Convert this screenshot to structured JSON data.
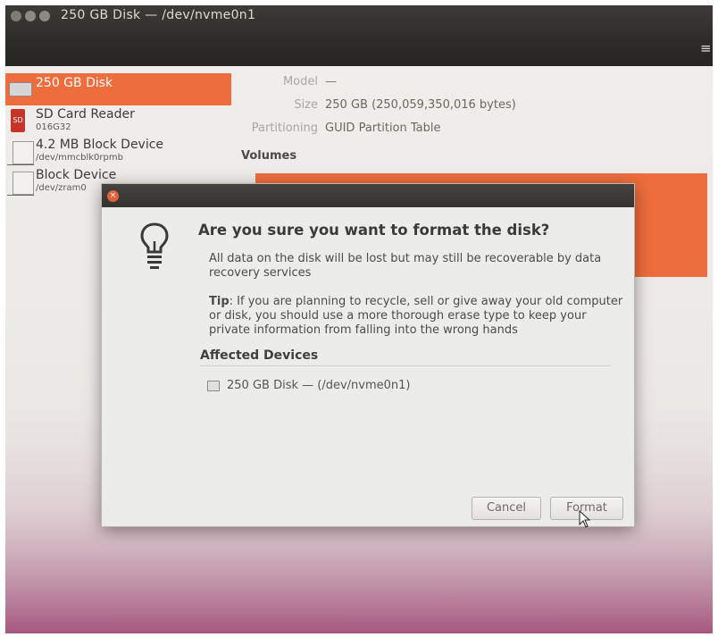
{
  "window": {
    "title": "250 GB Disk — /dev/nvme0n1",
    "menu_glyph": "≡"
  },
  "sidebar": {
    "items": [
      {
        "label": "250 GB Disk",
        "sub": "",
        "selected": true,
        "icon": "disk-icon"
      },
      {
        "label": "SD Card Reader",
        "sub": "016G32",
        "icon": "sd-card-icon",
        "icon_text": "SD"
      },
      {
        "label": "4.2 MB Block Device",
        "sub": "/dev/mmcblk0rpmb",
        "icon": "block-device-icon"
      },
      {
        "label": "Block Device",
        "sub": "/dev/zram0",
        "icon": "block-device-icon"
      }
    ]
  },
  "disk_info": {
    "model_label": "Model",
    "model_value": "—",
    "size_label": "Size",
    "size_value": "250 GB (250,059,350,016 bytes)",
    "partitioning_label": "Partitioning",
    "partitioning_value": "GUID Partition Table",
    "volumes_label": "Volumes"
  },
  "dialog": {
    "close_glyph": "×",
    "heading": "Are you sure you want to format the disk?",
    "body": "All data on the disk will be lost but may still be recoverable by data recovery services",
    "tip_label": "Tip",
    "tip_text": ": If you are planning to recycle, sell or give away your old computer or disk, you should use a more thorough erase type to keep your private information from falling into the wrong hands",
    "affected_label": "Affected Devices",
    "affected_device": "250 GB Disk — (/dev/nvme0n1)",
    "cancel_label": "Cancel",
    "format_label": "Format"
  },
  "colors": {
    "accent": "#ee6d3d",
    "titlebar": "#2e2d2a",
    "dialog_bg": "#ececea"
  }
}
